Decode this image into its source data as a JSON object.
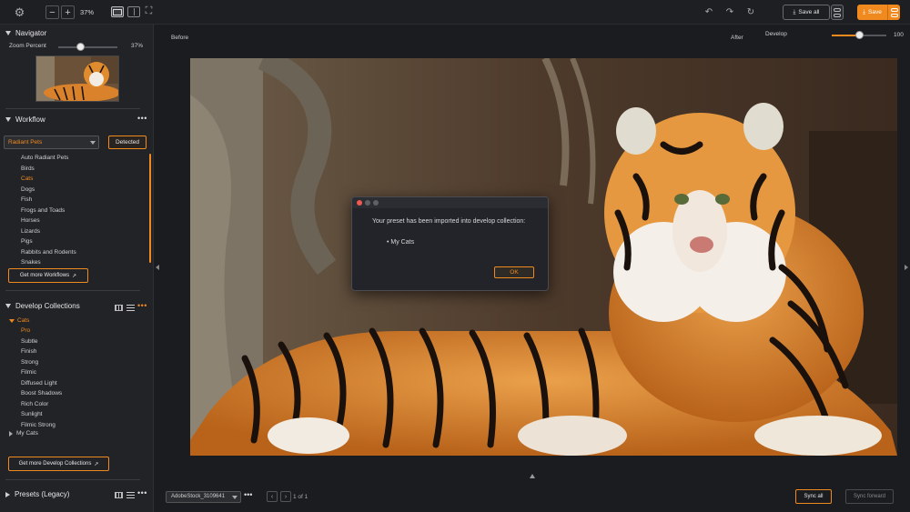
{
  "toolbar": {
    "zoom_value": "37%",
    "save_all_label": "Save all",
    "save_label": "Save",
    "accent_color": "#f08a1f"
  },
  "navigator": {
    "title": "Navigator",
    "zoom_label": "Zoom Percent",
    "zoom_value": "37%",
    "zoom_fraction": 0.37
  },
  "workflow": {
    "title": "Workflow",
    "selected_preset": "Radiant Pets",
    "detected_label": "Detected",
    "items": [
      {
        "label": "Auto Radiant Pets",
        "active": false
      },
      {
        "label": "Birds",
        "active": false
      },
      {
        "label": "Cats",
        "active": true
      },
      {
        "label": "Dogs",
        "active": false
      },
      {
        "label": "Fish",
        "active": false
      },
      {
        "label": "Frogs and Toads",
        "active": false
      },
      {
        "label": "Horses",
        "active": false
      },
      {
        "label": "Lizards",
        "active": false
      },
      {
        "label": "Pigs",
        "active": false
      },
      {
        "label": "Rabbits and Rodents",
        "active": false
      },
      {
        "label": "Snakes",
        "active": false
      }
    ],
    "get_more_label": "Get more Workflows"
  },
  "develop_collections": {
    "title": "Develop Collections",
    "group_label": "Cats",
    "items": [
      {
        "label": "Pro",
        "active": true
      },
      {
        "label": "Subtle",
        "active": false
      },
      {
        "label": "Finish",
        "active": false
      },
      {
        "label": "Strong",
        "active": false
      },
      {
        "label": "Filmic",
        "active": false
      },
      {
        "label": "Diffused Light",
        "active": false
      },
      {
        "label": "Boost Shadows",
        "active": false
      },
      {
        "label": "Rich Color",
        "active": false
      },
      {
        "label": "Sunlight",
        "active": false
      },
      {
        "label": "Filmic Strong",
        "active": false
      }
    ],
    "my_cats_label": "My Cats",
    "get_more_label": "Get more Develop Collections"
  },
  "presets": {
    "title": "Presets (Legacy)"
  },
  "main": {
    "before_label": "Before",
    "after_label": "After",
    "develop_label": "Develop",
    "develop_value": "100",
    "develop_fraction": 0.5
  },
  "dialog": {
    "message": "Your preset has been imported into develop collection:",
    "item": "• My Cats",
    "ok_label": "OK"
  },
  "bottom": {
    "file_name": "AdobeStock_3109641",
    "page_text": "1 of 1",
    "sync_all_label": "Sync all",
    "sync_forward_label": "Sync forward"
  }
}
